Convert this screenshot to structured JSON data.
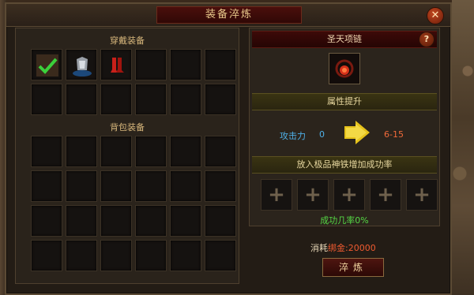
{
  "window": {
    "title": "装备淬炼",
    "close_symbol": "✕"
  },
  "left_panel": {
    "worn_label": "穿戴装备",
    "bag_label": "背包装备",
    "worn_items": [
      "check-item",
      "silver-armor",
      "red-boots"
    ]
  },
  "right_panel": {
    "help_symbol": "?",
    "item_name": "圣天项链",
    "attr_header": "属性提升",
    "stat": {
      "name": "攻击力",
      "from": "0",
      "to": "6-15"
    },
    "boost_header": "放入极品神铁增加成功率",
    "add_symbol": "+",
    "success_text": "成功几率0%"
  },
  "cost": {
    "prefix": "消耗",
    "currency": "绑金",
    "amount": ":20000"
  },
  "refine_button": "淬炼",
  "colors": {
    "accent_gold": "#e9c98b",
    "stat_blue": "#4fb0e8",
    "stat_red": "#f06a3a",
    "success_green": "#55d845"
  }
}
